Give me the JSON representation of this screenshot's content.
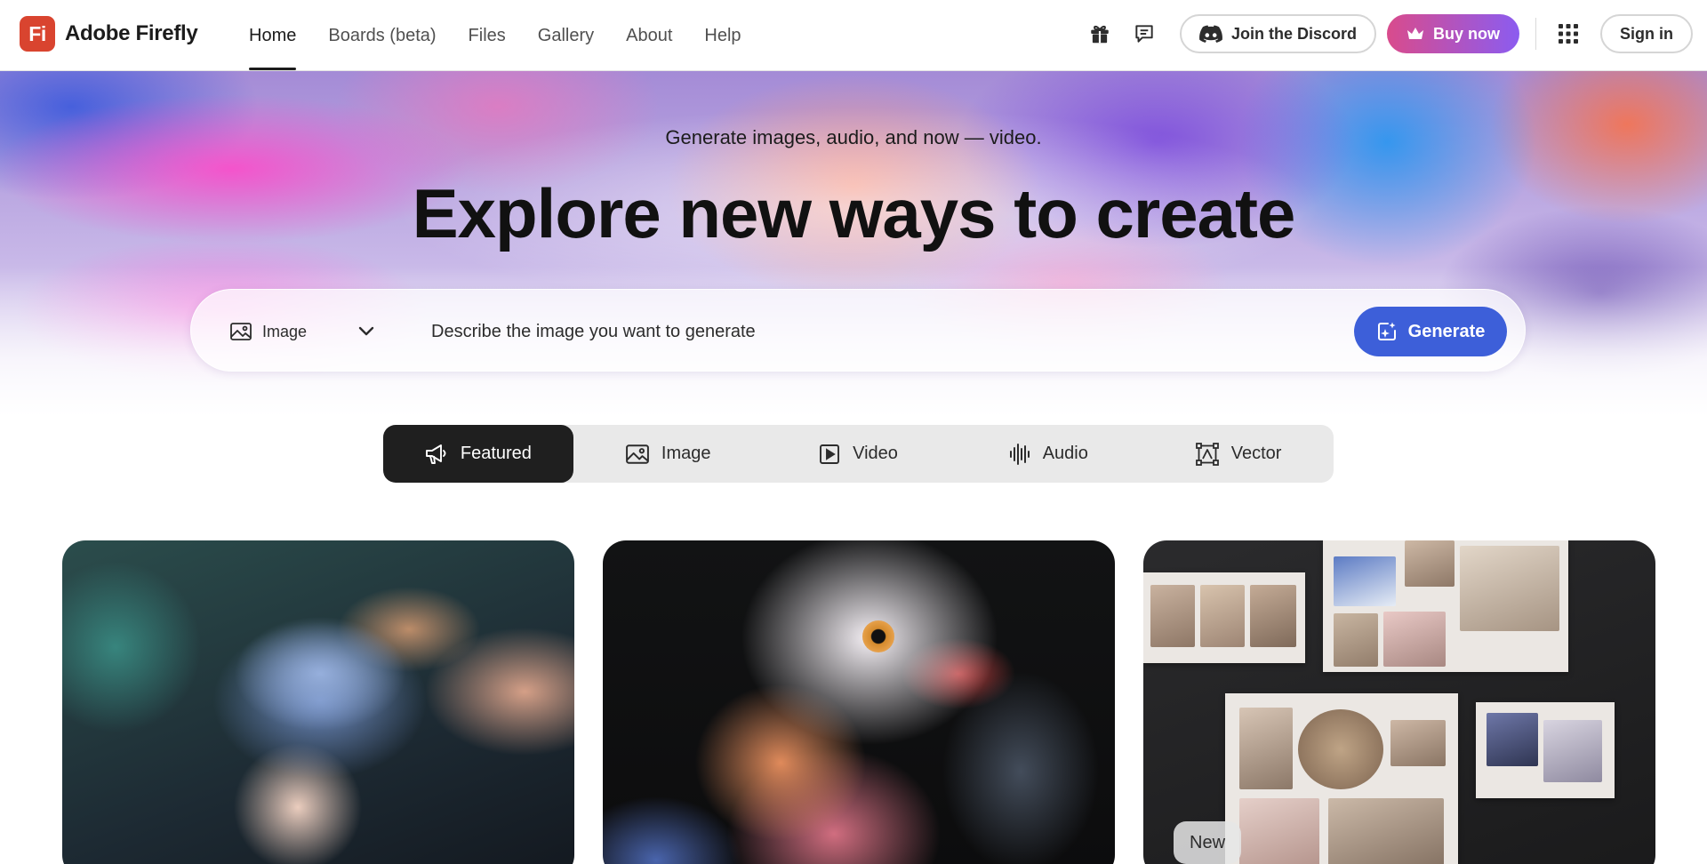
{
  "brand": {
    "logo_mark": "Fi",
    "name": "Adobe Firefly"
  },
  "nav": {
    "items": [
      {
        "label": "Home",
        "active": true
      },
      {
        "label": "Boards (beta)",
        "active": false
      },
      {
        "label": "Files",
        "active": false
      },
      {
        "label": "Gallery",
        "active": false
      },
      {
        "label": "About",
        "active": false
      },
      {
        "label": "Help",
        "active": false
      }
    ]
  },
  "header_actions": {
    "icons": [
      "gift-icon",
      "feedback-icon",
      "discord-icon",
      "crown-icon",
      "apps-grid-icon"
    ],
    "discord_label": "Join the Discord",
    "buy_label": "Buy now",
    "sign_in_label": "Sign in"
  },
  "hero": {
    "subtitle": "Generate images, audio, and now — video.",
    "title": "Explore new ways to create"
  },
  "prompt": {
    "mode_icon": "image-icon",
    "mode_value": "Image",
    "placeholder": "Describe the image you want to generate",
    "value": "",
    "generate_label": "Generate"
  },
  "category_tabs": [
    {
      "label": "Featured",
      "icon": "megaphone-icon",
      "active": true
    },
    {
      "label": "Image",
      "icon": "image-icon",
      "active": false
    },
    {
      "label": "Video",
      "icon": "video-play-icon",
      "active": false
    },
    {
      "label": "Audio",
      "icon": "audio-wave-icon",
      "active": false
    },
    {
      "label": "Vector",
      "icon": "vector-icon",
      "active": false
    }
  ],
  "cards": [
    {
      "badge": ""
    },
    {
      "badge": ""
    },
    {
      "badge": "New"
    }
  ],
  "colors": {
    "brand_red": "#d9442f",
    "generate_blue": "#3d5fd9",
    "buy_gradient_start": "#d94b8c",
    "buy_gradient_end": "#8b5cf0",
    "active_tab": "#1f1f1f"
  }
}
